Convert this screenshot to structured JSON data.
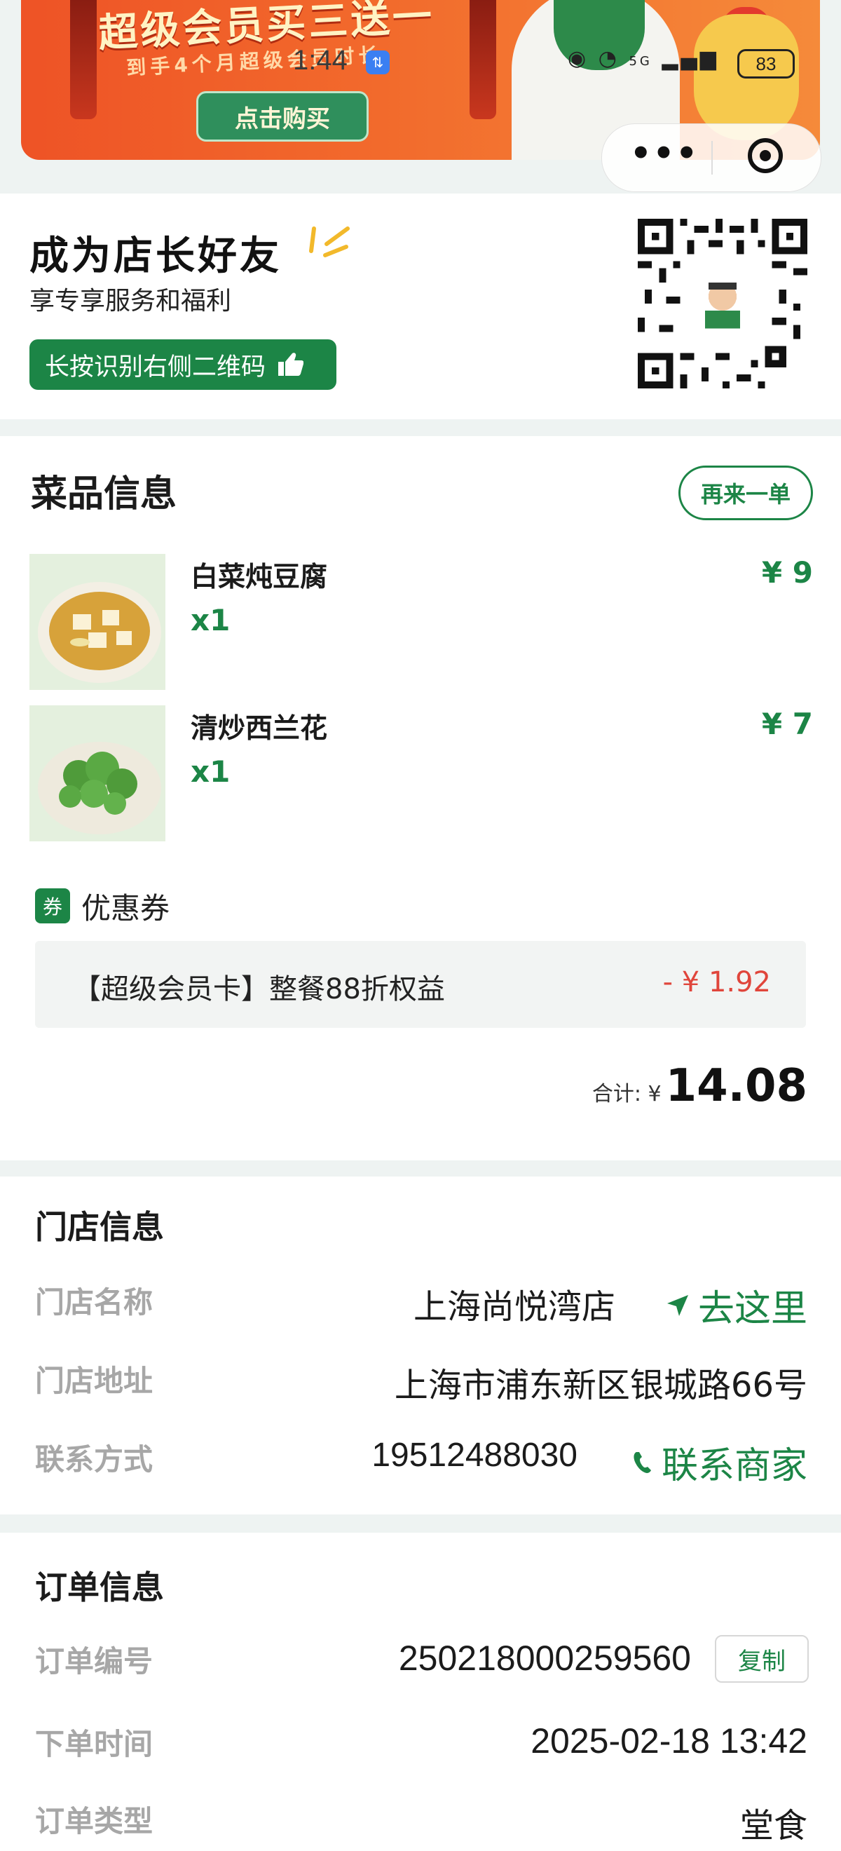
{
  "status_bar": {
    "time": "1:44",
    "badge": "⇅",
    "network": "5G",
    "battery": "83"
  },
  "banner": {
    "title": "超级会员买三送一",
    "subtitle": "到手4个月超级会员时长",
    "button": "点击购买"
  },
  "capsule": {
    "more_label": "•••"
  },
  "friend": {
    "title": "成为店长好友",
    "subtitle": "享专享服务和福利",
    "button": "长按识别右侧二维码"
  },
  "dishes": {
    "title": "菜品信息",
    "reorder": "再来一单",
    "items": [
      {
        "name": "白菜炖豆腐",
        "qty": "x1",
        "price": "¥ 9"
      },
      {
        "name": "清炒西兰花",
        "qty": "x1",
        "price": "¥ 7"
      }
    ],
    "coupon": {
      "tag": "券",
      "label": "优惠券",
      "name": "【超级会员卡】整餐88折权益",
      "discount": "- ¥ 1.92"
    },
    "total_label": "合计: ¥",
    "total_value": "14.08"
  },
  "store": {
    "title": "门店信息",
    "name_key": "门店名称",
    "name_val": "上海尚悦湾店",
    "navigate": "去这里",
    "addr_key": "门店地址",
    "addr_val": "上海市浦东新区银城路66号",
    "contact_key": "联系方式",
    "contact_val": "19512488030",
    "contact_action": "联系商家"
  },
  "order": {
    "title": "订单信息",
    "no_key": "订单编号",
    "no_val": "250218000259560",
    "copy": "复制",
    "time_key": "下单时间",
    "time_val": "2025-02-18 13:42",
    "type_key": "订单类型",
    "type_val": "堂食"
  },
  "colors": {
    "brand_green": "#1c8546",
    "discount_red": "#e0453b",
    "banner_orange": "#ee5326"
  }
}
